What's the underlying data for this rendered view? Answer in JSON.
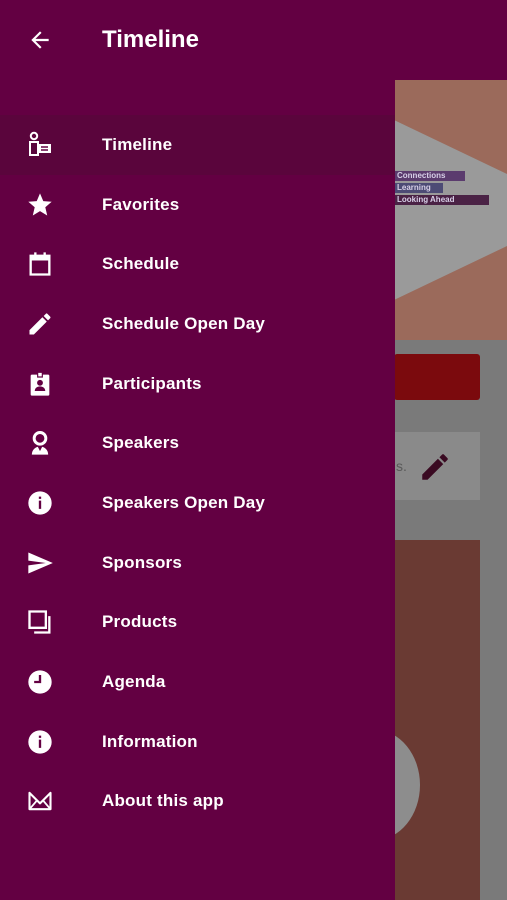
{
  "header": {
    "title": "Timeline"
  },
  "menu": {
    "items": [
      {
        "label": "Timeline",
        "icon": "speaker-podium-icon",
        "active": true
      },
      {
        "label": "Favorites",
        "icon": "star-icon"
      },
      {
        "label": "Schedule",
        "icon": "calendar-icon"
      },
      {
        "label": "Schedule Open Day",
        "icon": "pencil-icon"
      },
      {
        "label": "Participants",
        "icon": "badge-icon"
      },
      {
        "label": "Speakers",
        "icon": "person-icon"
      },
      {
        "label": "Speakers Open Day",
        "icon": "info-icon"
      },
      {
        "label": "Sponsors",
        "icon": "send-icon"
      },
      {
        "label": "Products",
        "icon": "copy-icon"
      },
      {
        "label": "Agenda",
        "icon": "clock-icon"
      },
      {
        "label": "Information",
        "icon": "info-icon"
      },
      {
        "label": "About this app",
        "icon": "about-icon"
      }
    ]
  },
  "background": {
    "banner_tags": [
      "Connections",
      "Learning",
      "Looking Ahead"
    ],
    "card_text": "s."
  },
  "colors": {
    "drawer": "#630042",
    "text": "#ffffff"
  }
}
